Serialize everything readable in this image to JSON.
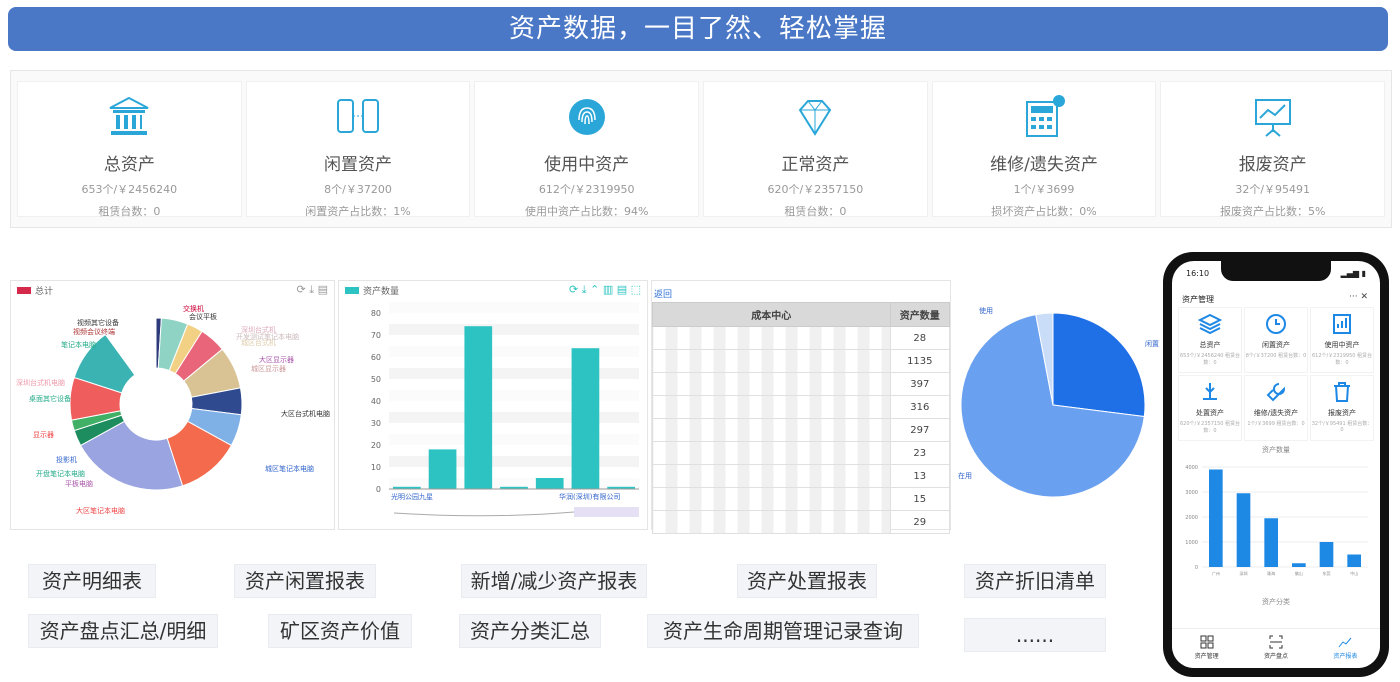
{
  "banner": "资产数据，一目了然、轻松掌握",
  "cards": [
    {
      "icon": "bank-icon",
      "title": "总资产",
      "line1": "653个/￥2456240",
      "line2": "租赁台数：0"
    },
    {
      "icon": "idle-phones-icon",
      "title": "闲置资产",
      "line1": "8个/￥37200",
      "line2": "闲置资产占比数：1%"
    },
    {
      "icon": "fingerprint-icon",
      "title": "使用中资产",
      "line1": "612个/￥2319950",
      "line2": "使用中资产占比数：94%"
    },
    {
      "icon": "diamond-icon",
      "title": "正常资产",
      "line1": "620个/￥2357150",
      "line2": "租赁台数：0"
    },
    {
      "icon": "calculator-icon",
      "title": "维修/遗失资产",
      "line1": "1个/￥3699",
      "line2": "损坏资产占比数：0%"
    },
    {
      "icon": "chart-board-icon",
      "title": "报废资产",
      "line1": "32个/￥95491",
      "line2": "报废资产占比数：5%"
    }
  ],
  "donut": {
    "legend": "总计",
    "labels": [
      "交换机",
      "会议平板",
      "视频其它设备",
      "视频会议终端",
      "笔记本电脑",
      "深圳台式机电脑",
      "桌面其它设备",
      "显示器",
      "投影机",
      "开盘笔记本电脑",
      "平板电脑",
      "大区笔记本电脑",
      "大区显示器",
      "大区台式机电脑",
      "城区笔记本电脑",
      "城区显示器",
      "城区台式机",
      "开发测试笔记本电脑",
      "深圳台式机"
    ],
    "colors": [
      "#2e3a7a",
      "#8fd3c4",
      "#f2d084",
      "#e8657a",
      "#d9c394",
      "#2f4a8f",
      "#7fb0e6",
      "#f46a4c",
      "#9aa4e0",
      "#1d8c5e",
      "#3fb065",
      "#f05d5d",
      "#3bb3b2",
      "#ffffff"
    ]
  },
  "bar": {
    "legend": "资产数量",
    "yticks": [
      "80",
      "70",
      "60",
      "50",
      "40",
      "30",
      "20",
      "10",
      "0"
    ],
    "values": [
      1,
      18,
      74,
      1,
      5,
      64,
      1
    ],
    "xlabel_left": "光明公园九星",
    "xlabel_right": "华润(深圳)有限公司",
    "color": "#2ec3c3"
  },
  "table": {
    "back": "返回",
    "col1": "成本中心",
    "col2": "资产数量",
    "rows": [
      "28",
      "1135",
      "397",
      "316",
      "297",
      "23",
      "13",
      "15",
      "29"
    ]
  },
  "pie": {
    "labels": [
      "使用",
      "闲置",
      "在用"
    ],
    "values": [
      70,
      27,
      3
    ],
    "colors": [
      "#6aa0f0",
      "#1f6fe6",
      "#c9dcf8"
    ]
  },
  "reports": [
    "资产明细表",
    "资产闲置报表",
    "新增/减少资产报表",
    "资产处置报表",
    "资产折旧清单",
    "资产盘点汇总/明细",
    "矿区资产价值",
    "资产分类汇总",
    "资产生命周期管理记录查询",
    "......"
  ],
  "phone": {
    "time": "16:10",
    "title": "资产管理",
    "close": "···  ✕",
    "cells": [
      {
        "name": "总资产",
        "sub": "653个/￥2456240 租赁台数：0"
      },
      {
        "name": "闲置资产",
        "sub": "8个/￥37200 租赁台数：0"
      },
      {
        "name": "使用中资产",
        "sub": "612个/￥2319950 租赁台数：0"
      },
      {
        "name": "处置资产",
        "sub": "620个/￥2357150 租赁台数：0"
      },
      {
        "name": "维修/遗失资产",
        "sub": "1个/￥3699 租赁台数：0"
      },
      {
        "name": "报废资产",
        "sub": "32个/￥95491 租赁台数：0"
      }
    ],
    "chart_title": "资产数量",
    "yticks": [
      "4000",
      "3000",
      "2000",
      "1000",
      "0"
    ],
    "values": [
      3900,
      2950,
      1950,
      150,
      1000,
      500
    ],
    "xcats": [
      "广州",
      "深圳",
      "珠海",
      "佛山",
      "东莞",
      "中山"
    ],
    "section2": "资产分类",
    "tabs": [
      "资产管理",
      "资产盘点",
      "资产报表"
    ]
  }
}
